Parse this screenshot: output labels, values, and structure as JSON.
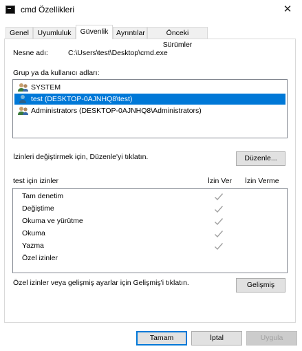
{
  "window": {
    "title": "cmd Özellikleri",
    "close_glyph": "✕"
  },
  "tabs": [
    {
      "label": "Genel"
    },
    {
      "label": "Uyumluluk"
    },
    {
      "label": "Güvenlik"
    },
    {
      "label": "Ayrıntılar"
    },
    {
      "label": "Önceki Sürümler"
    }
  ],
  "object_name": {
    "label": "Nesne adı:",
    "value": "C:\\Users\\test\\Desktop\\cmd.exe"
  },
  "groups": {
    "label": "Grup ya da kullanıcı adları:",
    "items": [
      {
        "label": "SYSTEM",
        "icon": "group-icon"
      },
      {
        "label": "test (DESKTOP-0AJNHQ8\\test)",
        "icon": "user-icon",
        "selected": true
      },
      {
        "label": "Administrators (DESKTOP-0AJNHQ8\\Administrators)",
        "icon": "group-icon"
      }
    ]
  },
  "change_hint": "İzinleri değiştirmek için, Düzenle'yi tıklatın.",
  "edit_button": "Düzenle...",
  "permissions": {
    "header": "test için izinler",
    "allow_header": "İzin Ver",
    "deny_header": "İzin Verme",
    "rows": [
      {
        "name": "Tam denetim",
        "allow": true
      },
      {
        "name": "Değiştime",
        "allow": true
      },
      {
        "name": "Okuma ve yürütme",
        "allow": true
      },
      {
        "name": "Okuma",
        "allow": true
      },
      {
        "name": "Yazma",
        "allow": true
      },
      {
        "name": "Özel izinler",
        "allow": false
      }
    ],
    "check_color": "#a0a0a0"
  },
  "advanced_hint": "Özel izinler veya gelişmiş ayarlar için Gelişmiş'i tıklatın.",
  "advanced_button": "Gelişmiş",
  "footer": {
    "ok": "Tamam",
    "cancel": "İptal",
    "apply": "Uygula"
  },
  "colors": {
    "selection": "#0078d7",
    "focus_border": "#0078d7"
  }
}
